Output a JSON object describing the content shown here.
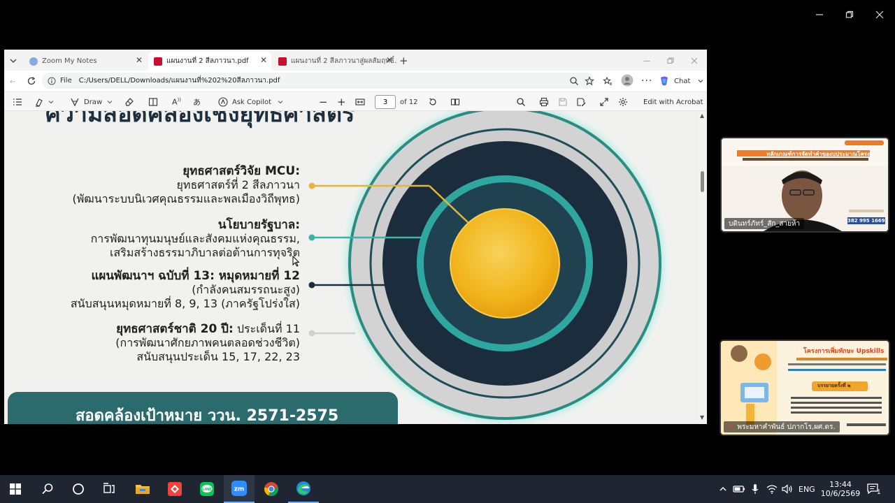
{
  "tabs": [
    {
      "label": "Zoom My Notes",
      "icon": "zoom-icon",
      "active": false
    },
    {
      "label": "แผนงานที่ 2 สีลภาวนา.pdf",
      "icon": "pdf-icon",
      "active": true
    },
    {
      "label": "แผนงานที่ 2 สีลภาวนาสู่ผลสัมฤทธิ์.pdf",
      "icon": "pdf-icon",
      "active": false
    }
  ],
  "address": {
    "scheme_label": "File",
    "url": "C:/Users/DELL/Downloads/แผนงานที่%202%20สีลภาวนา.pdf"
  },
  "browser": {
    "chat_label": "Chat"
  },
  "pdf_toolbar": {
    "draw_label": "Draw",
    "ask_copilot_label": "Ask Copilot",
    "page_current": "3",
    "page_total": "of 12",
    "edit_label": "Edit with Acrobat"
  },
  "slide": {
    "title": "ความสอดคล้องเชิงยุทธศาสตร์",
    "items": [
      {
        "heading": "ยุทธศาสตร์วิจัย MCU:",
        "inline": "",
        "lines": [
          "ยุทธศาสตร์ที่ 2 สีลภาวนา",
          "(พัฒนาระบบนิเวศคุณธรรมและพลเมืองวิถีพุทธ)"
        ],
        "dot_color": "#e6b43a"
      },
      {
        "heading": "นโยบายรัฐบาล:",
        "inline": "",
        "lines": [
          "การพัฒนาทุนมนุษย์และสังคมแห่งคุณธรรม,",
          "เสริมสร้างธรรมาภิบาลต่อต้านการทุจริต"
        ],
        "dot_color": "#3fb2a8"
      },
      {
        "heading": "แผนพัฒนาฯ ฉบับที่ 13: หมุดหมายที่ 12",
        "inline": "",
        "lines": [
          "(กำลังคนสมรรถนะสูง)",
          "สนับสนุนหมุดหมายที่ 8, 9, 13 (ภาครัฐโปร่งใส)"
        ],
        "dot_color": "#1b2d3c"
      },
      {
        "heading": "ยุทธศาสตร์ชาติ 20 ปี:",
        "inline": " ประเด็นที่ 11",
        "lines": [
          "(การพัฒนาศักยภาพคนตลอดช่วงชีวิต)",
          "สนับสนุนประเด็น 15, 17, 22, 23"
        ],
        "dot_color": "#cfcfcf"
      }
    ],
    "bottom_banner": "สอดคล้องเป้าหมาย ววน. 2571-2575"
  },
  "videos": [
    {
      "name": "บดินทร์ภัทร์_สัก_สายห้า",
      "id_badge": "382 995 1669",
      "poster_title": "หลักเกณฑ์การจัดทำคำของบประมาณโครงการวิจัย"
    },
    {
      "name": "พระมหาคำพันธ์  ปภากโร,ผศ.ดร.",
      "poster_title": "โครงการเพิ่มทักษะ Upskills",
      "poster_sub": "บรรยายครั้งที่ ๒"
    }
  ],
  "taskbar": {
    "apps": [
      "start-icon",
      "search-icon",
      "cortana-icon",
      "task-view-icon",
      "file-explorer-icon",
      "anydesk-icon",
      "line-icon",
      "zoom-icon",
      "chrome-icon",
      "edge-icon"
    ],
    "lang": "ENG",
    "time": "13:44",
    "date": "10/6/2569",
    "notification_count": "1"
  },
  "colors": {
    "accent_teal": "#2c6b6d",
    "navy": "#1b2d3c",
    "gold": "#f2b51c",
    "taskbar": "#1f2631"
  }
}
